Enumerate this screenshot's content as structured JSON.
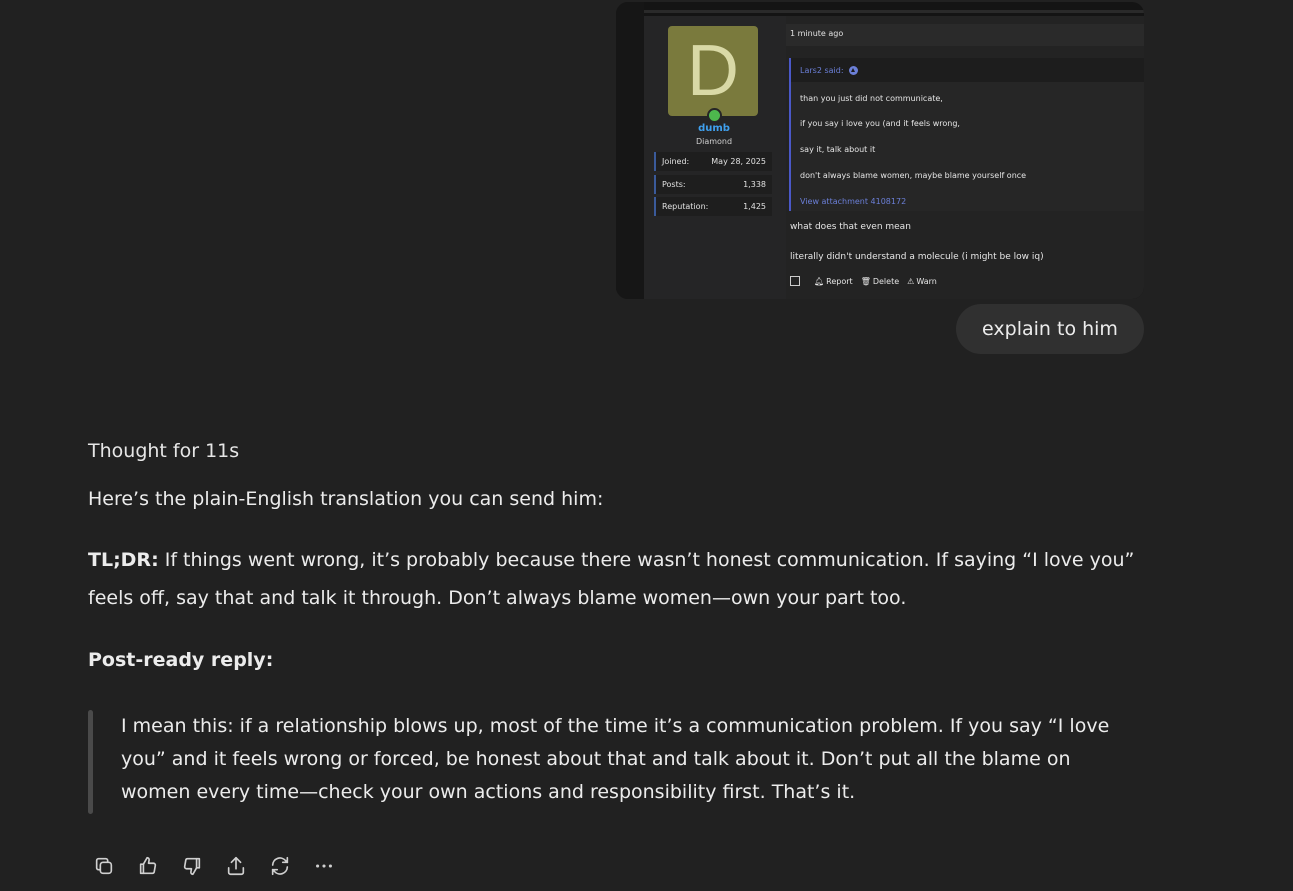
{
  "attachment": {
    "avatar_letter": "D",
    "username": "dumb",
    "rank": "Diamond",
    "stats": [
      {
        "label": "Joined:",
        "value": "May 28, 2025"
      },
      {
        "label": "Posts:",
        "value": "1,338"
      },
      {
        "label": "Reputation:",
        "value": "1,425"
      }
    ],
    "timestamp": "1 minute ago",
    "quote": {
      "author": "Lars2 said:",
      "lines": [
        "than you just did not communicate,",
        "if you say i love you (and it feels wrong,",
        "say it, talk about it",
        "don't always blame women, maybe blame yourself once"
      ],
      "attachment_link": "View attachment 4108172"
    },
    "post_lines": [
      "what does that even mean",
      "literally didn't understand a molecule (i might be low iq)"
    ],
    "actions": {
      "report": "Report",
      "delete": "Delete",
      "warn": "Warn"
    }
  },
  "user_message": "explain to him",
  "assistant": {
    "thought": "Thought for 11s",
    "intro": "Here’s the plain-English translation you can send him:",
    "tldr_label": "TL;DR:",
    "tldr_text": " If things went wrong, it’s probably because there wasn’t honest communication. If saying “I love you” feels off, say that and talk it through. Don’t always blame women—own your part too.",
    "post_ready_label": "Post-ready reply:",
    "reply": "I mean this: if a relationship blows up, most of the time it’s a communication problem. If you say “I love you” and it feels wrong or forced, be honest about that and talk about it. Don’t put all the blame on women every time—check your own actions and responsibility first. That’s it."
  },
  "toolbar": [
    "copy-icon",
    "thumbs-up-icon",
    "thumbs-down-icon",
    "share-icon",
    "regenerate-icon",
    "more-icon"
  ]
}
